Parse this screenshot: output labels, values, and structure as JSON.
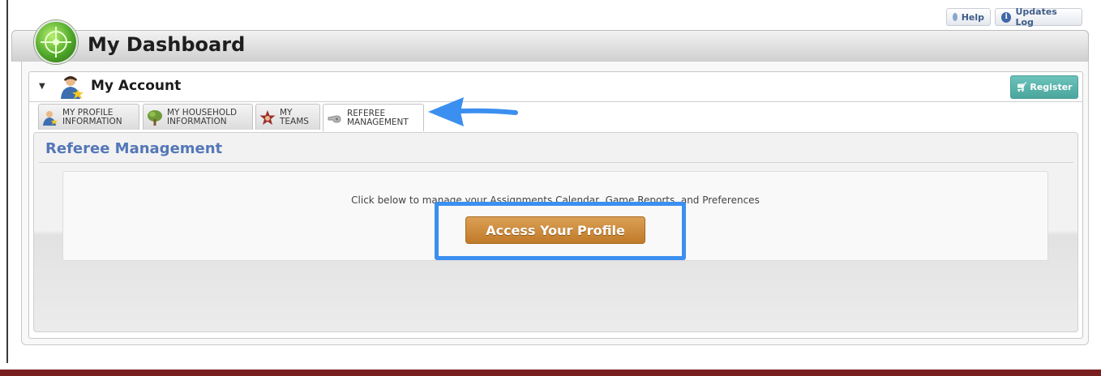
{
  "toolbar": {
    "help_label": "Help",
    "updates_label": "Updates Log"
  },
  "dashboard": {
    "title": "My Dashboard"
  },
  "account": {
    "title": "My Account",
    "register_label": "Register",
    "tabs": [
      {
        "line1": "MY PROFILE",
        "line2": "INFORMATION"
      },
      {
        "line1": "MY HOUSEHOLD",
        "line2": "INFORMATION"
      },
      {
        "line1": "MY",
        "line2": "TEAMS"
      },
      {
        "line1": "REFEREE",
        "line2": "MANAGEMENT"
      }
    ],
    "active_tab": "REFEREE MANAGEMENT"
  },
  "referee": {
    "title": "Referee Management",
    "instructions": "Click below to manage your Assignments Calendar, Game Reports, and Preferences",
    "access_button": "Access Your Profile"
  },
  "annotations": {
    "arrow_color": "#3b8ff0",
    "highlight_color": "#3b8ff0"
  },
  "colors": {
    "section_title": "#5477b8",
    "access_button": "#c98a3a",
    "register_button": "#5bb5ad"
  }
}
